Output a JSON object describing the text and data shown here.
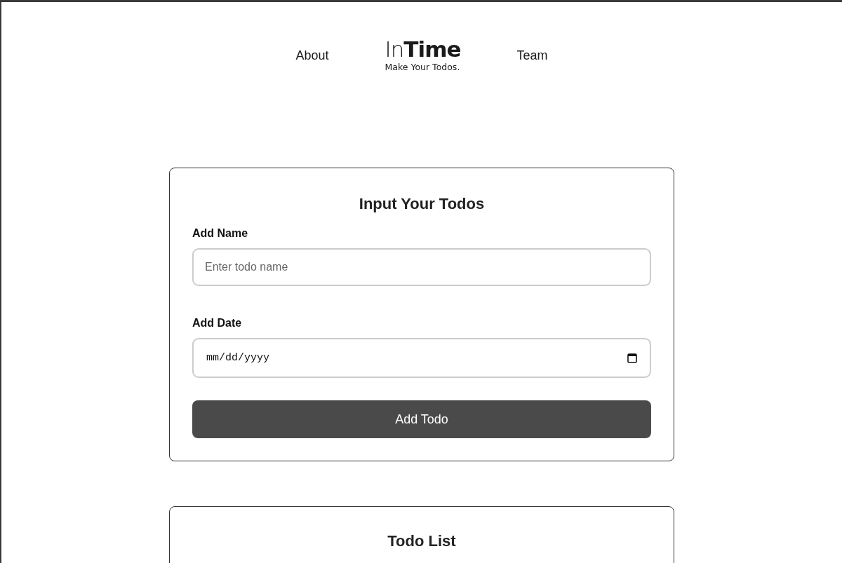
{
  "nav": {
    "links": [
      {
        "label": "About"
      },
      {
        "label": "Team"
      }
    ],
    "logo": {
      "title": "In**Time**",
      "tagline": "Make Your Todos."
    }
  },
  "form": {
    "title": "Input Your Todos",
    "fields": [
      {
        "kind": "text",
        "label": "Add Name",
        "placeholder": "Enter todo name"
      },
      {
        "kind": "date",
        "label": "Add Date",
        "placeholder": "mm/dd/yyyy"
      }
    ],
    "button": "Add Todo"
  },
  "list": {
    "title": "Todo List"
  }
}
